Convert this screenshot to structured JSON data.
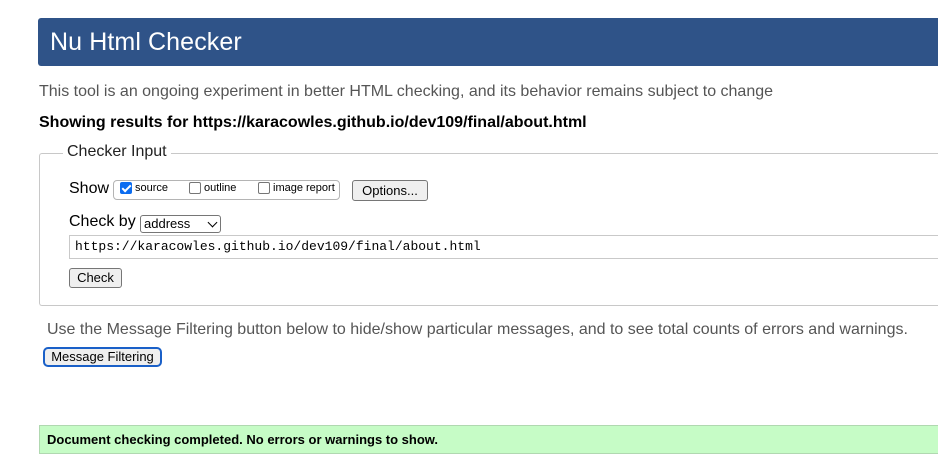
{
  "header": {
    "title": "Nu Html Checker"
  },
  "intro_text": "This tool is an ongoing experiment in better HTML checking, and its behavior remains subject to change",
  "showing_text": "Showing results for https://karacowles.github.io/dev109/final/about.html",
  "checker_input": {
    "legend": "Checker Input",
    "show_label": "Show",
    "options": [
      {
        "label": "source",
        "checked": true
      },
      {
        "label": "outline",
        "checked": false
      },
      {
        "label": "image report",
        "checked": false
      }
    ],
    "options_button": "Options...",
    "check_by_label": "Check by",
    "check_by_value": "address",
    "url_value": "https://karacowles.github.io/dev109/final/about.html",
    "check_button": "Check"
  },
  "filter": {
    "note": "Use the Message Filtering button below to hide/show particular messages, and to see total counts of errors and warnings.",
    "button": "Message Filtering"
  },
  "result": {
    "message": "Document checking completed. No errors or warnings to show."
  },
  "colors": {
    "header_bg": "#2f5388",
    "success_bg": "#c6fcc6",
    "checkbox_accent": "#0b6cf0"
  }
}
